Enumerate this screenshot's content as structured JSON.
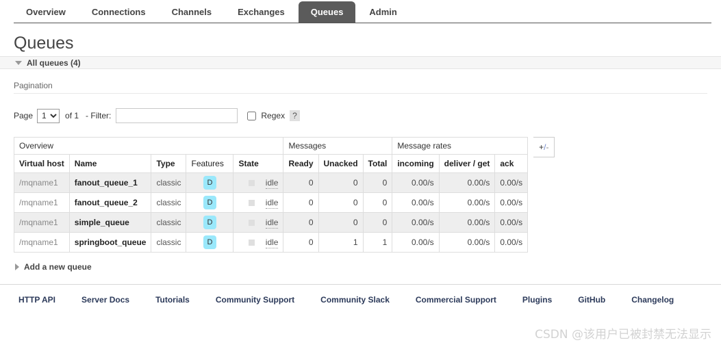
{
  "nav": {
    "tabs": [
      {
        "label": "Overview",
        "active": false
      },
      {
        "label": "Connections",
        "active": false
      },
      {
        "label": "Channels",
        "active": false
      },
      {
        "label": "Exchanges",
        "active": false
      },
      {
        "label": "Queues",
        "active": true
      },
      {
        "label": "Admin",
        "active": false
      }
    ]
  },
  "page": {
    "title": "Queues",
    "section_band_label": "All queues (4)"
  },
  "pagination": {
    "heading": "Pagination",
    "page_label": "Page",
    "page_value": "1",
    "page_options": [
      "1"
    ],
    "of_text": "of 1",
    "filter_label": "- Filter:",
    "filter_value": "",
    "filter_placeholder": "",
    "regex_label": "Regex",
    "regex_checked": false,
    "help_label": "?"
  },
  "table": {
    "group_headers": [
      {
        "label": "Overview",
        "span": 5
      },
      {
        "label": "Messages",
        "span": 3
      },
      {
        "label": "Message rates",
        "span": 3
      }
    ],
    "columns": [
      {
        "label": "Virtual host",
        "bold": true,
        "align": "left"
      },
      {
        "label": "Name",
        "bold": true,
        "align": "left"
      },
      {
        "label": "Type",
        "bold": true,
        "align": "left"
      },
      {
        "label": "Features",
        "bold": false,
        "align": "left"
      },
      {
        "label": "State",
        "bold": true,
        "align": "left"
      },
      {
        "label": "Ready",
        "bold": true,
        "align": "left"
      },
      {
        "label": "Unacked",
        "bold": true,
        "align": "left"
      },
      {
        "label": "Total",
        "bold": true,
        "align": "left"
      },
      {
        "label": "incoming",
        "bold": true,
        "align": "left"
      },
      {
        "label": "deliver / get",
        "bold": true,
        "align": "left"
      },
      {
        "label": "ack",
        "bold": true,
        "align": "left"
      }
    ],
    "rows": [
      {
        "vhost": "/mqname1",
        "name": "fanout_queue_1",
        "type": "classic",
        "feature": "D",
        "state": "idle",
        "ready": "0",
        "unacked": "0",
        "total": "0",
        "incoming": "0.00/s",
        "deliver_get": "0.00/s",
        "ack": "0.00/s"
      },
      {
        "vhost": "/mqname1",
        "name": "fanout_queue_2",
        "type": "classic",
        "feature": "D",
        "state": "idle",
        "ready": "0",
        "unacked": "0",
        "total": "0",
        "incoming": "0.00/s",
        "deliver_get": "0.00/s",
        "ack": "0.00/s"
      },
      {
        "vhost": "/mqname1",
        "name": "simple_queue",
        "type": "classic",
        "feature": "D",
        "state": "idle",
        "ready": "0",
        "unacked": "0",
        "total": "0",
        "incoming": "0.00/s",
        "deliver_get": "0.00/s",
        "ack": "0.00/s"
      },
      {
        "vhost": "/mqname1",
        "name": "springboot_queue",
        "type": "classic",
        "feature": "D",
        "state": "idle",
        "ready": "0",
        "unacked": "1",
        "total": "1",
        "incoming": "0.00/s",
        "deliver_get": "0.00/s",
        "ack": "0.00/s"
      }
    ],
    "toggle_columns_label": "+/-"
  },
  "add_queue": {
    "label": "Add a new queue"
  },
  "footer": {
    "links": [
      "HTTP API",
      "Server Docs",
      "Tutorials",
      "Community Support",
      "Community Slack",
      "Commercial Support",
      "Plugins",
      "GitHub",
      "Changelog"
    ]
  },
  "watermark": {
    "text": "CSDN @该用户已被封禁无法显示"
  },
  "colors": {
    "active_tab_bg": "#5b5b5b",
    "feature_badge_bg": "#9ae8fb",
    "row_alt_bg": "#eeeeee",
    "footer_link": "#2c3a5a",
    "band_bg": "#f6f6f6"
  }
}
